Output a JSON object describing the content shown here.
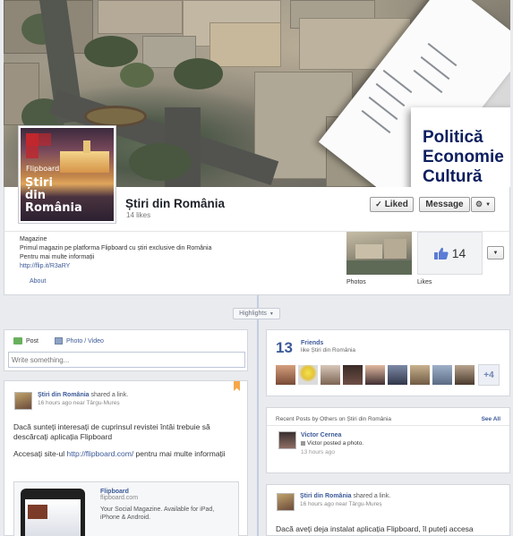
{
  "cover": {
    "words": [
      "Politică",
      "Economie",
      "Cultură"
    ]
  },
  "profile": {
    "brand": "Flipboard",
    "line1": "Știri",
    "line2": "din",
    "line3": "România"
  },
  "page": {
    "title": "Știri din România",
    "likes_label": "14 likes"
  },
  "actions": {
    "liked": "Liked",
    "message": "Message"
  },
  "about": {
    "category": "Magazine",
    "desc1": "Primul magazin pe platforma Flipboard cu știri exclusive din România",
    "desc2": "Pentru mai multe informații",
    "link": "http://flip.it/R3aRY",
    "about_label": "About"
  },
  "tiles": {
    "photos_label": "Photos",
    "likes_label": "Likes",
    "likes_count": "14"
  },
  "timeline": {
    "highlights": "Highlights"
  },
  "composer": {
    "post_tab": "Post",
    "photo_tab": "Photo / Video",
    "placeholder": "Write something..."
  },
  "post1": {
    "author": "Știri din România",
    "action": "shared a link.",
    "meta": "16 hours ago near Târgu-Mureș",
    "para1": "Dacă sunteți interesați de cuprinsul revistei întâi trebuie să descărcați aplicația Flipboard",
    "para2_prefix": "Accesați site-ul ",
    "para2_link": "http://flipboard.com/",
    "para2_suffix": " pentru mai multe informații",
    "link_title": "Flipboard",
    "link_domain": "flipboard.com",
    "link_desc": "Your Social Magazine. Available for iPad, iPhone & Android."
  },
  "friends": {
    "count": "13",
    "label": "Friends",
    "sub": "like Știri din România",
    "more": "+4"
  },
  "recent": {
    "header": "Recent Posts by Others on Știri din România",
    "see_all": "See All",
    "name": "Victor Cernea",
    "action": "Victor posted a photo.",
    "time": "13 hours ago"
  },
  "post2": {
    "author": "Știri din România",
    "action": "shared a link.",
    "meta": "16 hours ago near Târgu-Mureș",
    "text": "Dacă aveți deja instalat aplicația Flipboard, îl puteți accesa"
  },
  "colors": {
    "facebook_blue": "#3b5998",
    "flipboard_red": "#c1272d",
    "cover_text": "#0c1e5e"
  }
}
